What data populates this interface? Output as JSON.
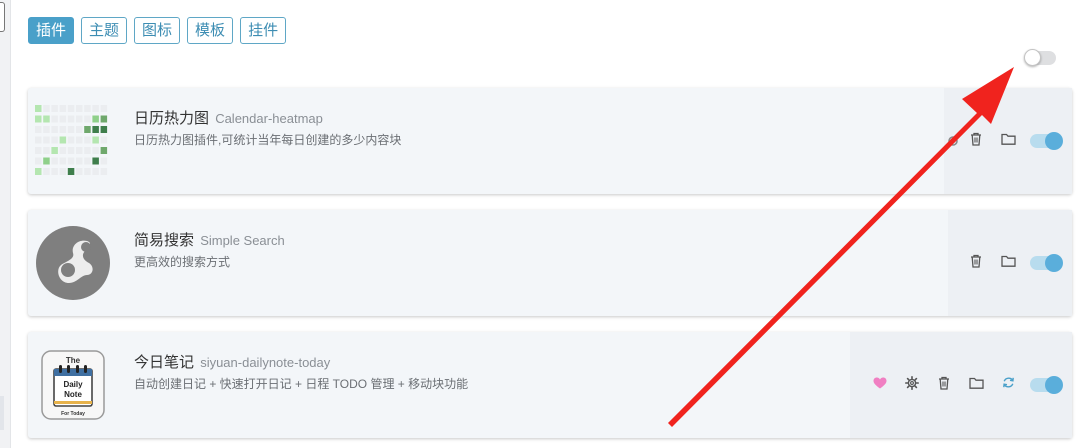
{
  "tabs": [
    {
      "label": "插件",
      "active": true
    },
    {
      "label": "主题",
      "active": false
    },
    {
      "label": "图标",
      "active": false
    },
    {
      "label": "模板",
      "active": false
    },
    {
      "label": "挂件",
      "active": false
    }
  ],
  "master_toggle": {
    "enabled": false
  },
  "plugins": [
    {
      "name": "日历热力图",
      "package": "Calendar-heatmap",
      "description": "日历热力图插件,可统计当年每日创建的多少内容块",
      "enabled": true,
      "icon": "calendar-heatmap-thumbnail",
      "actions": [
        "gear-icon",
        "trash-icon",
        "folder-icon"
      ]
    },
    {
      "name": "简易搜索",
      "package": "Simple Search",
      "description": "更高效的搜索方式",
      "enabled": true,
      "icon": "simple-search-logo",
      "actions": [
        "trash-icon",
        "folder-icon"
      ]
    },
    {
      "name": "今日笔记",
      "package": "siyuan-dailynote-today",
      "description": "自动创建日记 + 快速打开日记 + 日程 TODO 管理 + 移动块功能",
      "enabled": true,
      "icon": "daily-note-logo",
      "logo_text": {
        "top": "The",
        "line1": "Daily",
        "line2": "Note",
        "bottom": "For Today"
      },
      "actions": [
        "heart-icon",
        "gear-icon",
        "trash-icon",
        "folder-icon",
        "refresh-icon"
      ]
    }
  ],
  "colors": {
    "accent": "#4aa0c9",
    "toggle_on": "#5aaedb",
    "heart": "#f07fc2",
    "refresh": "#4aa0c9",
    "annotation_arrow": "#f0231e"
  }
}
